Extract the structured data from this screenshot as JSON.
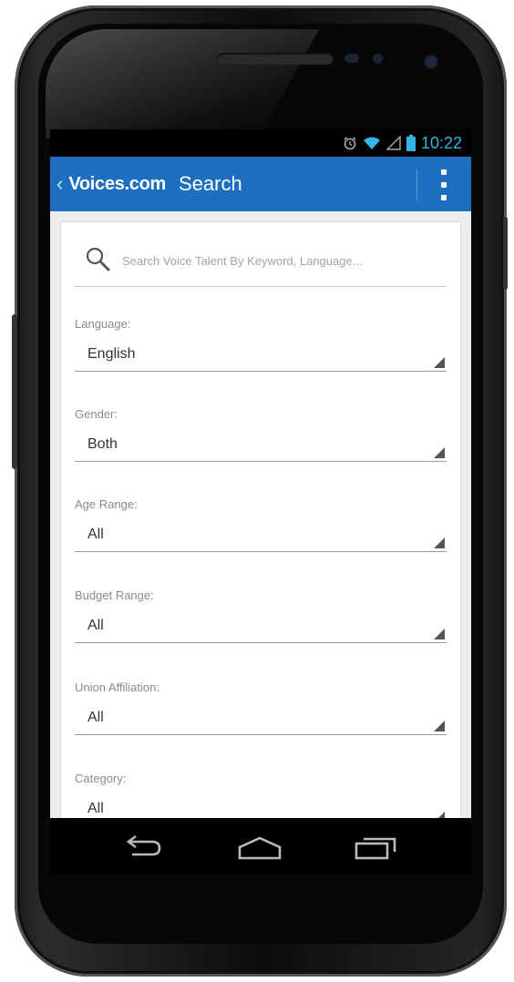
{
  "statusbar": {
    "time": "10:22"
  },
  "actionbar": {
    "back": "‹",
    "brand": "Voices.com",
    "title": "Search"
  },
  "search": {
    "placeholder": "Search Voice Talent By Keyword, Language..."
  },
  "fields": [
    {
      "label": "Language:",
      "value": "English"
    },
    {
      "label": "Gender:",
      "value": "Both"
    },
    {
      "label": "Age Range:",
      "value": "All"
    },
    {
      "label": "Budget Range:",
      "value": "All"
    },
    {
      "label": "Union Affiliation:",
      "value": "All"
    },
    {
      "label": "Category:",
      "value": "All"
    }
  ],
  "colors": {
    "actionbar": "#1e6fc2",
    "clock": "#33b5e5"
  },
  "icons": {
    "status": [
      "alarm-icon",
      "wifi-icon",
      "signal-icon",
      "battery-icon"
    ],
    "nav": [
      "back-icon",
      "home-icon",
      "recent-apps-icon"
    ]
  }
}
